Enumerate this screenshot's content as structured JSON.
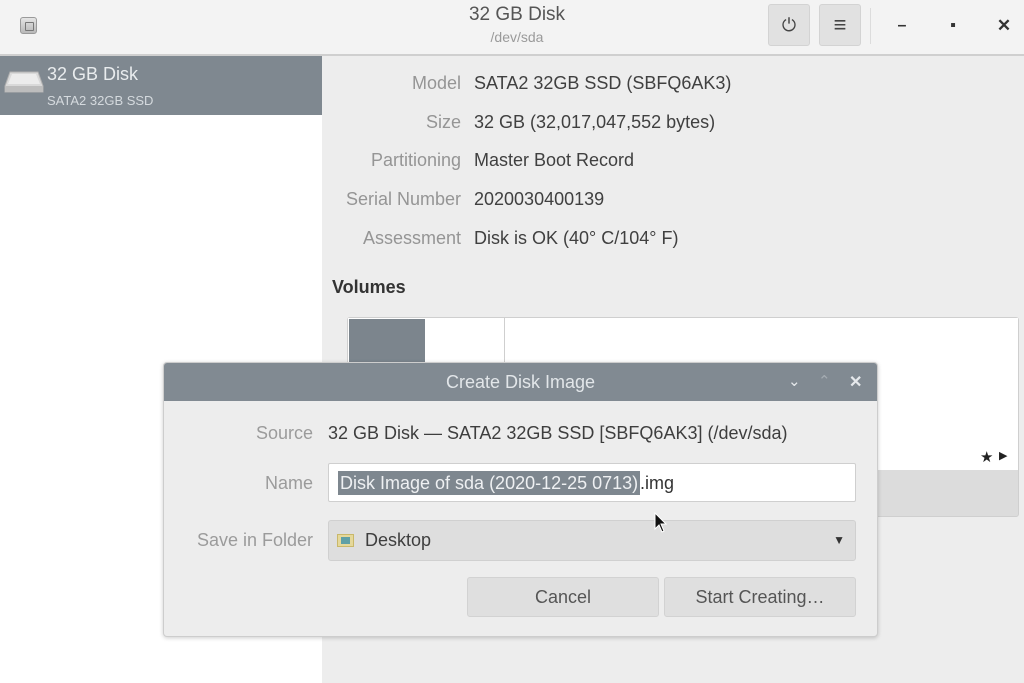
{
  "window": {
    "title": "32 GB Disk",
    "subtitle": "/dev/sda",
    "icons": {
      "app": "disks-app-icon",
      "power": "power-icon",
      "menu": "hamburger-menu-icon",
      "minimize": "minimize-icon",
      "maximize": "maximize-icon",
      "close": "close-icon"
    },
    "glyphs": {
      "power": "⏻",
      "menu": "≡",
      "minimize": "–",
      "maximize": "▪",
      "close": "✕"
    }
  },
  "sidebar": {
    "items": [
      {
        "name": "32 GB Disk",
        "subtitle": "SATA2 32GB SSD",
        "icon": "hard-disk-icon",
        "selected": true
      }
    ]
  },
  "details": {
    "rows": [
      {
        "label": "Model",
        "value": "SATA2 32GB SSD (SBFQ6AK3)"
      },
      {
        "label": "Size",
        "value": "32 GB (32,017,047,552 bytes)"
      },
      {
        "label": "Partitioning",
        "value": "Master Boot Record"
      },
      {
        "label": "Serial Number",
        "value": "2020030400139"
      },
      {
        "label": "Assessment",
        "value": "Disk is OK (40° C/104° F)"
      }
    ],
    "volumes_heading": "Volumes",
    "volume_icons": {
      "star": "★",
      "arrow": "▶"
    }
  },
  "dialog": {
    "title": "Create Disk Image",
    "controls": {
      "down": "⌄",
      "up": "⌃",
      "close": "✕"
    },
    "source_label": "Source",
    "source_value": "32 GB Disk — SATA2 32GB SSD [SBFQ6AK3] (/dev/sda)",
    "name_label": "Name",
    "name_value_selected": "Disk Image of sda (2020-12-25 0713)",
    "name_value_rest": ".img",
    "folder_label": "Save in Folder",
    "folder_value": "Desktop",
    "folder_caret": "▼",
    "cancel_label": "Cancel",
    "start_label": "Start Creating…"
  }
}
